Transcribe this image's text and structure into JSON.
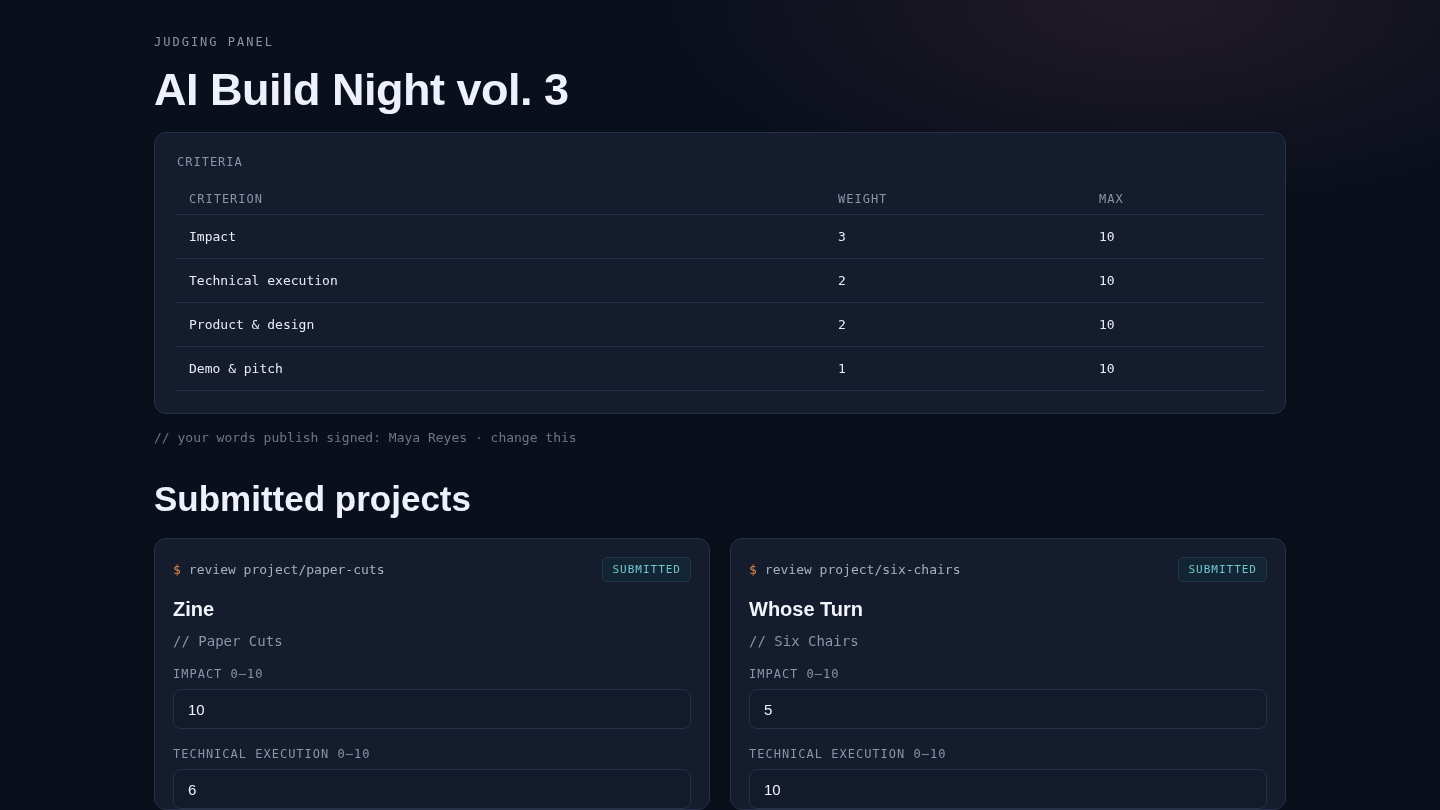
{
  "eyebrow": "JUDGING PANEL",
  "title": "AI Build Night vol. 3",
  "criteria": {
    "heading": "CRITERIA",
    "columns": [
      "CRITERION",
      "WEIGHT",
      "MAX"
    ],
    "rows": [
      [
        "Impact",
        "3",
        "10"
      ],
      [
        "Technical execution",
        "2",
        "10"
      ],
      [
        "Product & design",
        "2",
        "10"
      ],
      [
        "Demo & pitch",
        "1",
        "10"
      ]
    ]
  },
  "note": {
    "text": "// your words publish signed: Maya Reyes ·",
    "link": "change this"
  },
  "projects_heading": "Submitted projects",
  "projects": [
    {
      "prompt": "$",
      "command": "review project/paper-cuts",
      "status": "SUBMITTED",
      "name": "Zine",
      "team": "// Paper Cuts",
      "fields": [
        {
          "label": "IMPACT 0–10",
          "value": "10"
        },
        {
          "label": "TECHNICAL EXECUTION 0–10",
          "value": "6"
        }
      ]
    },
    {
      "prompt": "$",
      "command": "review project/six-chairs",
      "status": "SUBMITTED",
      "name": "Whose Turn",
      "team": "// Six Chairs",
      "fields": [
        {
          "label": "IMPACT 0–10",
          "value": "5"
        },
        {
          "label": "TECHNICAL EXECUTION 0–10",
          "value": "10"
        }
      ]
    }
  ]
}
